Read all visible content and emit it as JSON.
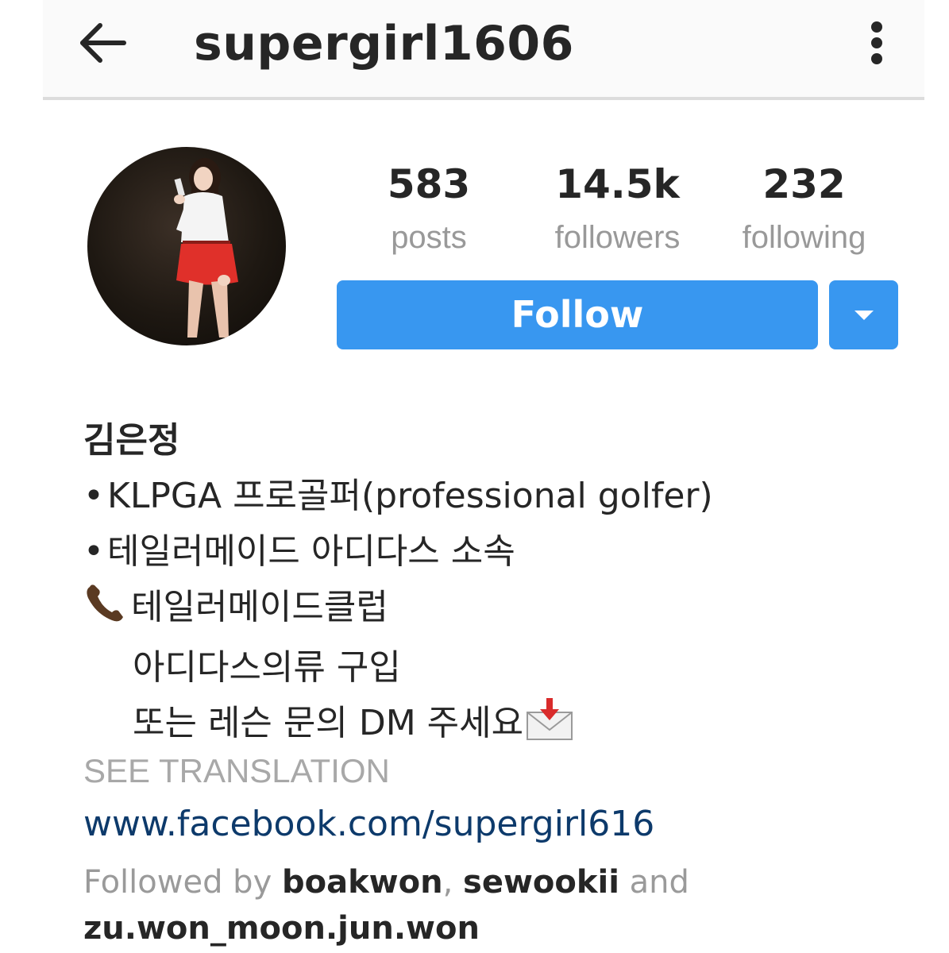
{
  "header": {
    "back_icon": "arrow-left-icon",
    "username": "supergirl1606",
    "more_icon": "more-vertical-icon"
  },
  "profile": {
    "avatar_icon": "profile-photo",
    "stats": {
      "posts_count": "583",
      "posts_label": "posts",
      "followers_count": "14.5k",
      "followers_label": "followers",
      "following_count": "232",
      "following_label": "following"
    },
    "follow_button_label": "Follow",
    "dropdown_icon": "caret-down-icon",
    "accent_color": "#3897f0"
  },
  "bio": {
    "name": "김은정",
    "bullet": "•",
    "line1": "KLPGA 프로골퍼(professional golfer)",
    "line2": "테일러메이드 아디다스 소속",
    "phone_icon": "telephone-receiver-icon",
    "line3": "테일러메이드클럽",
    "line4": "아디다스의류 구입",
    "line5": "또는 레슨 문의 DM 주세요",
    "mail_icon": "envelope-with-arrow-icon"
  },
  "see_translation_label": "SEE TRANSLATION",
  "website": "www.facebook.com/supergirl616",
  "followed_by": {
    "prefix": "Followed by ",
    "user1": "boakwon",
    "sep": ", ",
    "user2": "sewookii",
    "and": " and",
    "user3": "zu.won_moon.jun.won"
  },
  "link_color": "#0d3a6b"
}
